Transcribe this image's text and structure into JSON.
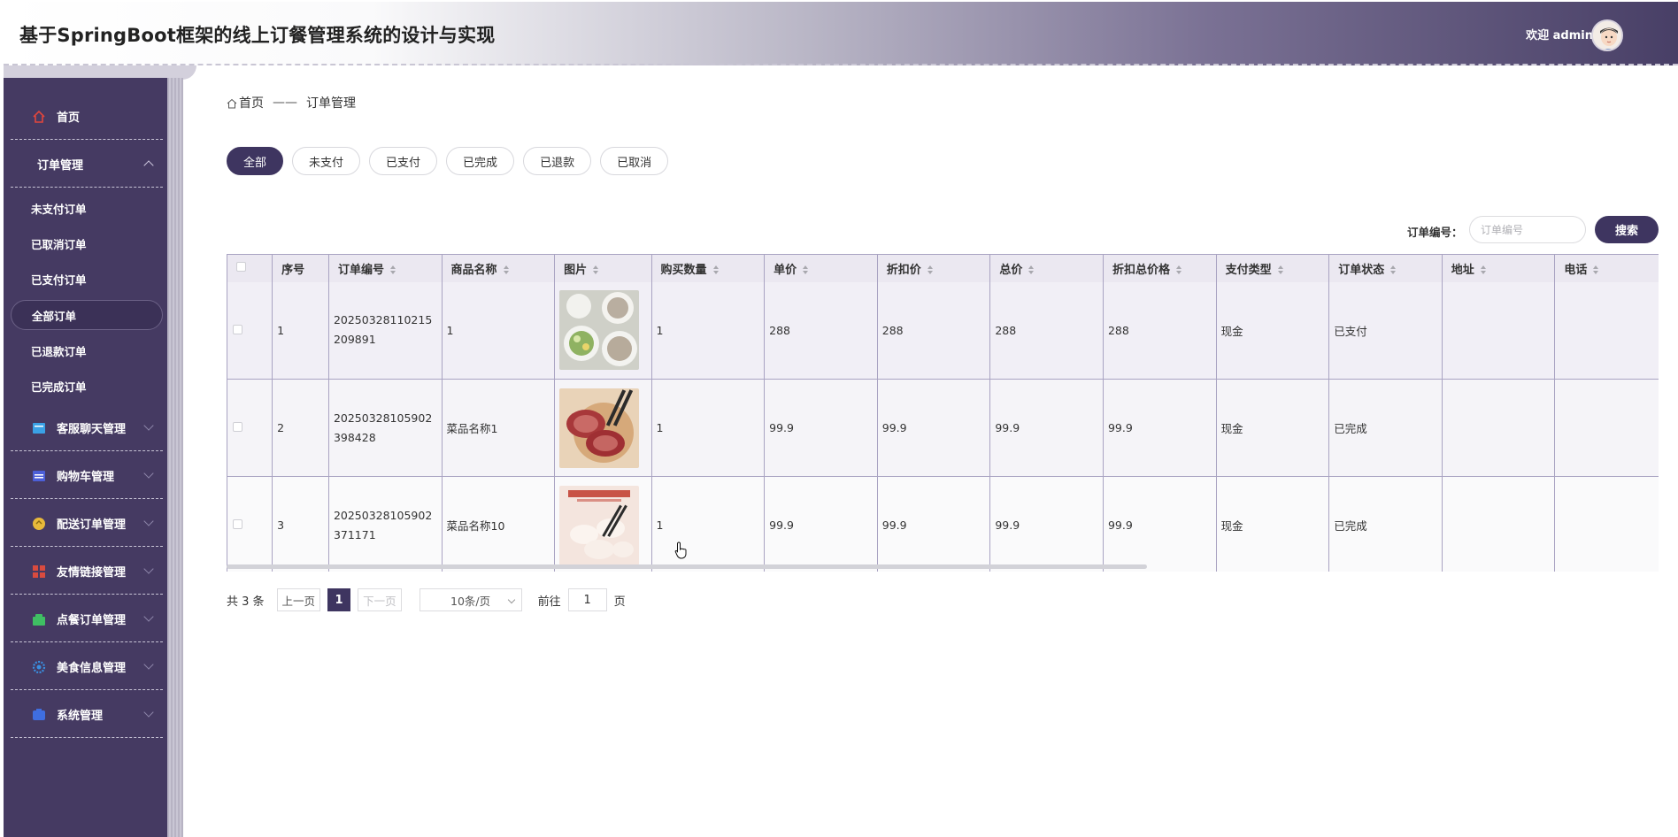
{
  "app": {
    "title": "基于SpringBoot框架的线上订餐管理系统的设计与实现",
    "welcome": "欢迎 admin"
  },
  "sidebar": {
    "items": [
      {
        "label": "首页",
        "icon": "home-icon",
        "color": "#e2463c"
      },
      {
        "label": "订单管理",
        "icon": "order-icon",
        "expanded": true
      },
      {
        "label": "客服聊天管理",
        "icon": "chat-icon",
        "color": "#3aa1e6"
      },
      {
        "label": "购物车管理",
        "icon": "cart-icon",
        "color": "#4c5fd8"
      },
      {
        "label": "配送订单管理",
        "icon": "delivery-icon",
        "color": "#e8b93a"
      },
      {
        "label": "友情链接管理",
        "icon": "link-icon",
        "color": "#d94b3f"
      },
      {
        "label": "点餐订单管理",
        "icon": "meal-order-icon",
        "color": "#3fbf63"
      },
      {
        "label": "美食信息管理",
        "icon": "food-icon",
        "color": "#3a8fe0"
      },
      {
        "label": "系统管理",
        "icon": "system-icon",
        "color": "#3f6ee0"
      }
    ],
    "order_subitems": [
      "未支付订单",
      "已取消订单",
      "已支付订单",
      "全部订单",
      "已退款订单",
      "已完成订单"
    ],
    "active_subitem": "全部订单"
  },
  "breadcrumb": {
    "home": "首页",
    "separator": "——",
    "current": "订单管理"
  },
  "filters": {
    "tabs": [
      "全部",
      "未支付",
      "已支付",
      "已完成",
      "已退款",
      "已取消"
    ],
    "active": "全部"
  },
  "search": {
    "label": "订单编号：",
    "placeholder": "订单编号",
    "button": "搜索"
  },
  "table": {
    "headers": [
      "序号",
      "订单编号",
      "商品名称",
      "图片",
      "购买数量",
      "单价",
      "折扣价",
      "总价",
      "折扣总价格",
      "支付类型",
      "订单状态",
      "地址",
      "电话"
    ],
    "rows": [
      {
        "index": "1",
        "order_no": "20250328110215209891",
        "name": "1",
        "image": "salad-and-grain-dishes",
        "qty": "1",
        "price": "288",
        "discount_price": "288",
        "total": "288",
        "discount_total": "288",
        "pay_type": "现金",
        "status": "已支付",
        "address": "",
        "phone": ""
      },
      {
        "index": "2",
        "order_no": "20250328105902398428",
        "name": "菜品名称1",
        "image": "sliced-sausage",
        "qty": "1",
        "price": "99.9",
        "discount_price": "99.9",
        "total": "99.9",
        "discount_total": "99.9",
        "pay_type": "现金",
        "status": "已完成",
        "address": "",
        "phone": ""
      },
      {
        "index": "3",
        "order_no": "20250328105902371171",
        "name": "菜品名称10",
        "image": "dumplings-poster",
        "qty": "1",
        "price": "99.9",
        "discount_price": "99.9",
        "total": "99.9",
        "discount_total": "99.9",
        "pay_type": "现金",
        "status": "已完成",
        "address": "",
        "phone": ""
      }
    ]
  },
  "pagination": {
    "total": "共 3 条",
    "prev": "上一页",
    "current": "1",
    "next": "下一页",
    "page_size": "10条/页",
    "goto": "前往",
    "goto_value": "1",
    "page_unit": "页"
  },
  "colors": {
    "accent": "#3e3560",
    "sidebar": "#453a62"
  }
}
